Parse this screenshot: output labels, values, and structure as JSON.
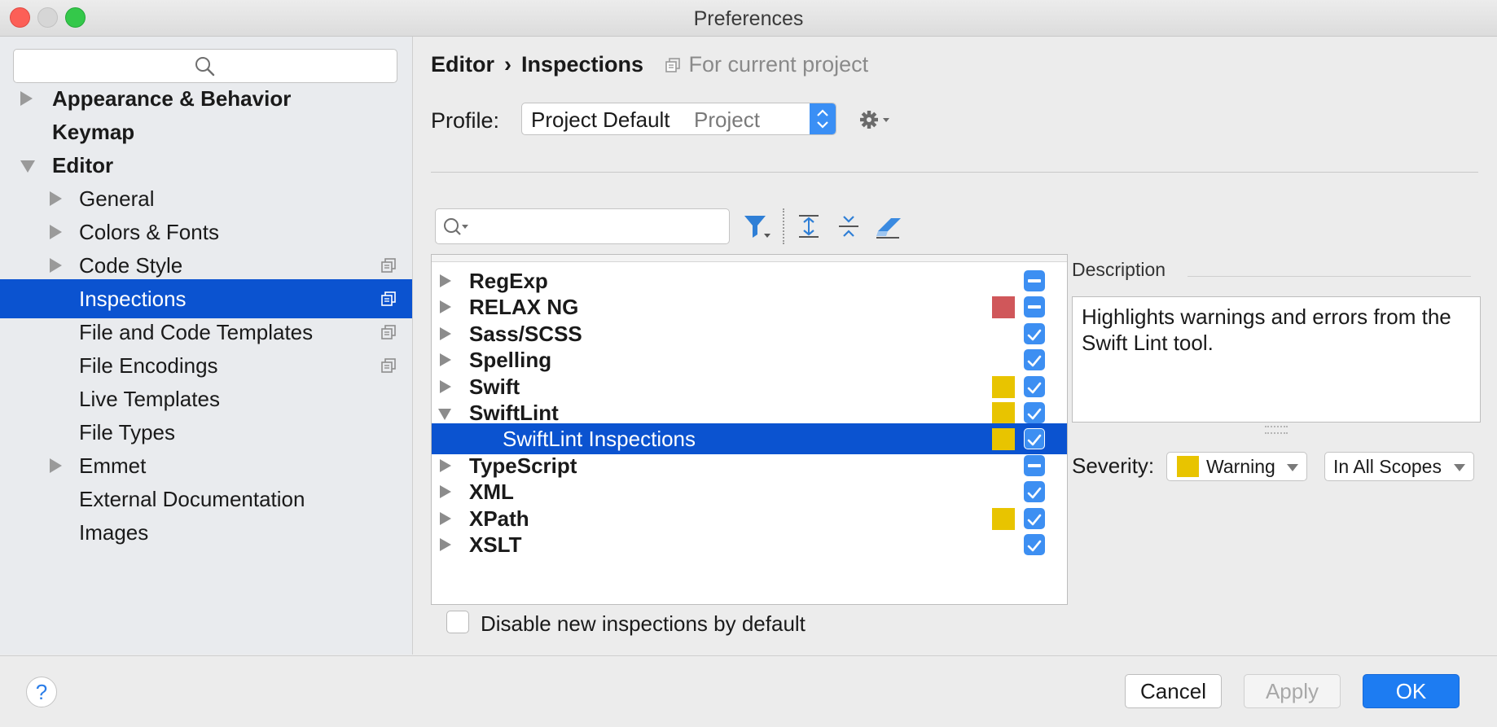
{
  "window": {
    "title": "Preferences"
  },
  "sidebar": {
    "search_placeholder": "",
    "items": [
      {
        "label": "Appearance & Behavior",
        "expandable": true,
        "expanded": false
      },
      {
        "label": "Keymap"
      },
      {
        "label": "Editor",
        "expandable": true,
        "expanded": true
      },
      {
        "label": "General",
        "expandable": true
      },
      {
        "label": "Colors & Fonts",
        "expandable": true
      },
      {
        "label": "Code Style",
        "expandable": true,
        "project_icon": true
      },
      {
        "label": "Inspections",
        "selected": true,
        "project_icon": true
      },
      {
        "label": "File and Code Templates",
        "project_icon": true
      },
      {
        "label": "File Encodings",
        "project_icon": true
      },
      {
        "label": "Live Templates"
      },
      {
        "label": "File Types"
      },
      {
        "label": "Emmet",
        "expandable": true
      },
      {
        "label": "External Documentation"
      },
      {
        "label": "Images"
      }
    ]
  },
  "header": {
    "breadcrumb_parent": "Editor",
    "breadcrumb_separator": "›",
    "breadcrumb_current": "Inspections",
    "scope_note": "For current project"
  },
  "profile": {
    "label": "Profile:",
    "value": "Project Default",
    "scope": "Project"
  },
  "filter": {
    "placeholder": ""
  },
  "inspections": [
    {
      "label": "RegExp",
      "state": "partial",
      "severity_color": null
    },
    {
      "label": "RELAX NG",
      "state": "partial",
      "severity_color": "#d0575a"
    },
    {
      "label": "Sass/SCSS",
      "state": "checked",
      "severity_color": null
    },
    {
      "label": "Spelling",
      "state": "checked",
      "severity_color": null
    },
    {
      "label": "Swift",
      "state": "checked",
      "severity_color": "#e8c400"
    },
    {
      "label": "SwiftLint",
      "state": "checked",
      "severity_color": "#e8c400",
      "expanded": true
    },
    {
      "label": "SwiftLint Inspections",
      "state": "checked",
      "severity_color": "#e8c400",
      "child": true,
      "selected": true
    },
    {
      "label": "TypeScript",
      "state": "partial",
      "severity_color": null
    },
    {
      "label": "XML",
      "state": "checked",
      "severity_color": null
    },
    {
      "label": "XPath",
      "state": "checked",
      "severity_color": "#e8c400"
    },
    {
      "label": "XSLT",
      "state": "checked",
      "severity_color": null
    }
  ],
  "description": {
    "label": "Description",
    "text": "Highlights warnings and errors from the Swift Lint tool."
  },
  "severity": {
    "label": "Severity:",
    "value": "Warning",
    "color": "#e8c400",
    "scope_value": "In All Scopes"
  },
  "disable_new": {
    "label": "Disable new inspections by default",
    "checked": false
  },
  "footer": {
    "help": "?",
    "cancel": "Cancel",
    "apply": "Apply",
    "ok": "OK"
  },
  "colors": {
    "accent": "#0b53d0",
    "checkbox_blue": "#3d8ff2",
    "ok_button": "#1d7cf2"
  }
}
